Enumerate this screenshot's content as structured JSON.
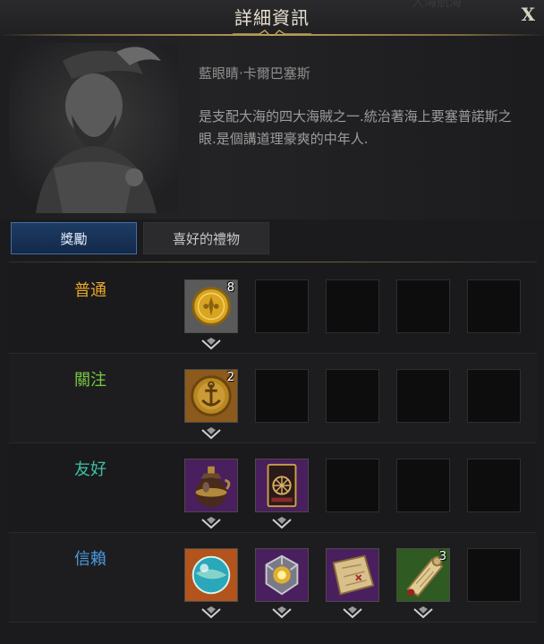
{
  "window": {
    "title": "詳細資訊",
    "ghost_title": "大海航海",
    "close_label": "X"
  },
  "npc": {
    "name": "藍眼睛·卡爾巴塞斯",
    "description": "是支配大海的四大海賊之一.統治著海上要塞普諾斯之眼.是個講道理豪爽的中年人."
  },
  "tabs": [
    {
      "label": "獎勵",
      "active": true
    },
    {
      "label": "喜好的禮物",
      "active": false
    }
  ],
  "reward_rows": [
    {
      "tier": "普通",
      "color": "#e8a72a",
      "items": [
        {
          "icon": "gold-coin-icon",
          "count": "8"
        }
      ]
    },
    {
      "tier": "關注",
      "color": "#7ac943",
      "items": [
        {
          "icon": "anchor-coin-icon",
          "count": "2"
        }
      ]
    },
    {
      "tier": "友好",
      "color": "#3fc0a8",
      "items": [
        {
          "icon": "potion-flask-icon",
          "count": ""
        },
        {
          "icon": "card-icon",
          "count": ""
        }
      ]
    },
    {
      "tier": "信賴",
      "color": "#4a9be0",
      "items": [
        {
          "icon": "orb-icon",
          "count": ""
        },
        {
          "icon": "gem-crest-icon",
          "count": ""
        },
        {
          "icon": "treasure-map-icon",
          "count": ""
        },
        {
          "icon": "scroll-icon",
          "count": "3"
        }
      ]
    }
  ]
}
